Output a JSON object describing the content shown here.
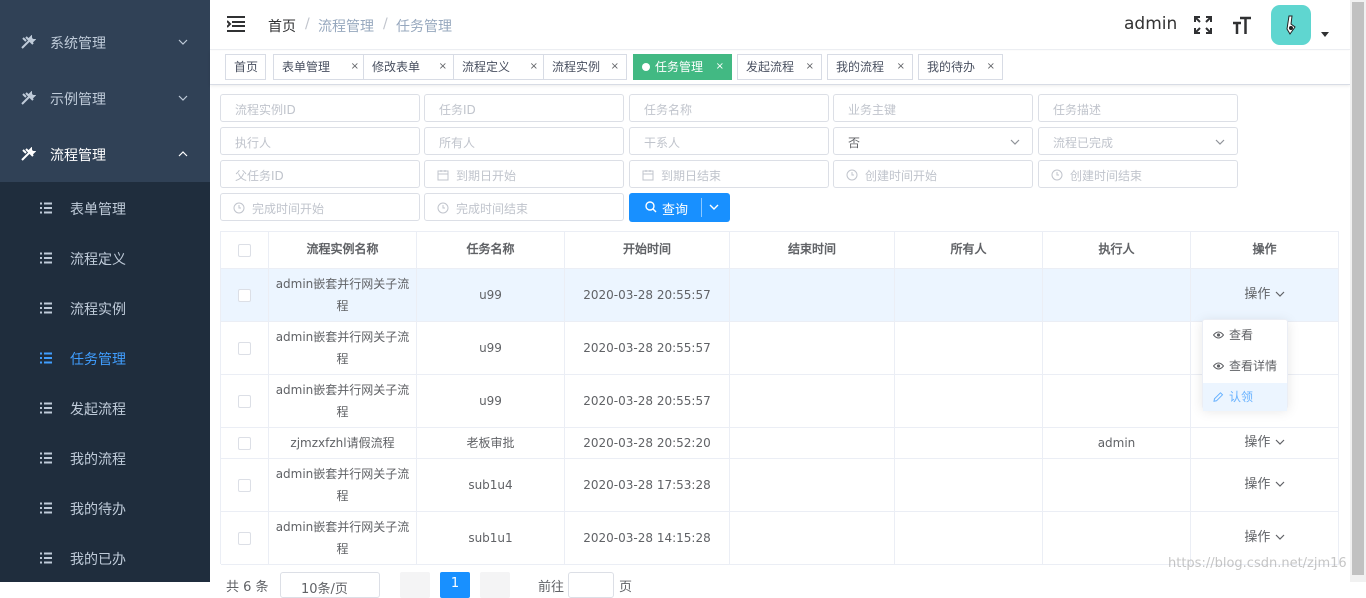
{
  "sidebar": {
    "menus": [
      {
        "label": "系统管理",
        "icon": "tools-icon"
      },
      {
        "label": "示例管理",
        "icon": "tools-icon"
      },
      {
        "label": "流程管理",
        "icon": "tools-icon"
      }
    ],
    "submenu": [
      {
        "label": "表单管理",
        "icon": "list-icon"
      },
      {
        "label": "流程定义",
        "icon": "list-icon"
      },
      {
        "label": "流程实例",
        "icon": "list-icon"
      },
      {
        "label": "任务管理",
        "icon": "list-icon",
        "active": true
      },
      {
        "label": "发起流程",
        "icon": "list-icon"
      },
      {
        "label": "我的流程",
        "icon": "list-icon"
      },
      {
        "label": "我的待办",
        "icon": "list-icon"
      },
      {
        "label": "我的已办",
        "icon": "list-icon"
      }
    ]
  },
  "header": {
    "breadcrumb": [
      "首页",
      "流程管理",
      "任务管理"
    ],
    "separator": "/",
    "user": "admin"
  },
  "tags": [
    {
      "label": "首页"
    },
    {
      "label": "表单管理",
      "close": "×"
    },
    {
      "label": "修改表单",
      "close": "×"
    },
    {
      "label": "流程定义",
      "close": "×"
    },
    {
      "label": "流程实例",
      "close": "×"
    },
    {
      "label": "任务管理",
      "close": "×",
      "active": true
    },
    {
      "label": "发起流程",
      "close": "×"
    },
    {
      "label": "我的流程",
      "close": "×"
    },
    {
      "label": "我的待办",
      "close": "×"
    }
  ],
  "filters": {
    "proc_inst_id": "流程实例ID",
    "task_id": "任务ID",
    "task_name": "任务名称",
    "business_key": "业务主键",
    "task_desc": "任务描述",
    "assignee": "执行人",
    "owner": "所有人",
    "candidate": "干系人",
    "suspended_value": "否",
    "finished_placeholder": "流程已完成",
    "parent_task_id": "父任务ID",
    "due_start": "到期日开始",
    "due_end": "到期日结束",
    "create_start": "创建时间开始",
    "create_end": "创建时间结束",
    "complete_start": "完成时间开始",
    "complete_end": "完成时间结束",
    "query_label": "查询"
  },
  "table": {
    "columns": [
      "流程实例名称",
      "任务名称",
      "开始时间",
      "结束时间",
      "所有人",
      "执行人",
      "操作"
    ],
    "rows": [
      {
        "process": "admin嵌套并行网关子流程",
        "task": "u99",
        "start": "2020-03-28 20:55:57",
        "end": "",
        "owner": "",
        "assignee": "",
        "op": "操作",
        "show_op": true
      },
      {
        "process": "admin嵌套并行网关子流程",
        "task": "u99",
        "start": "2020-03-28 20:55:57",
        "end": "",
        "owner": "",
        "assignee": "",
        "op": "操作",
        "show_op": false
      },
      {
        "process": "admin嵌套并行网关子流程",
        "task": "u99",
        "start": "2020-03-28 20:55:57",
        "end": "",
        "owner": "",
        "assignee": "",
        "op": "操作",
        "show_op": false
      },
      {
        "process": "zjmzxfzhl请假流程",
        "task": "老板审批",
        "start": "2020-03-28 20:52:20",
        "end": "",
        "owner": "",
        "assignee": "admin",
        "op": "操作",
        "show_op": true
      },
      {
        "process": "admin嵌套并行网关子流程",
        "task": "sub1u4",
        "start": "2020-03-28 17:53:28",
        "end": "",
        "owner": "",
        "assignee": "",
        "op": "操作",
        "show_op": true
      },
      {
        "process": "admin嵌套并行网关子流程",
        "task": "sub1u1",
        "start": "2020-03-28 14:15:28",
        "end": "",
        "owner": "",
        "assignee": "",
        "op": "操作",
        "show_op": true
      }
    ]
  },
  "dropdown": {
    "items": [
      {
        "label": "查看",
        "icon": "eye-icon"
      },
      {
        "label": "查看详情",
        "icon": "eye-icon"
      },
      {
        "label": "认领",
        "icon": "edit-icon",
        "highlight": true
      }
    ]
  },
  "pagination": {
    "total_text": "共 6 条",
    "page_size": "10条/页",
    "current_page": "1",
    "goto_label": "前往",
    "page_unit": "页"
  },
  "watermark": "https://blog.csdn.net/zjm16"
}
